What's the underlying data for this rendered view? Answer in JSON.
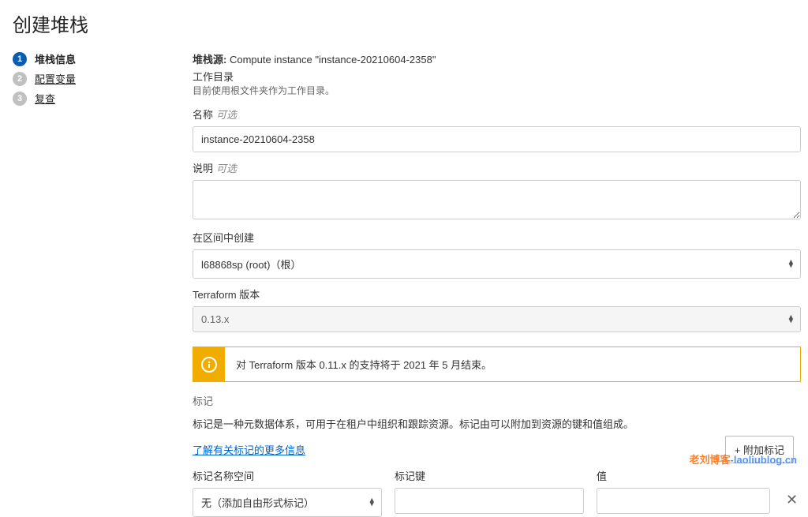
{
  "page_title": "创建堆栈",
  "steps": [
    {
      "num": "1",
      "label": "堆栈信息",
      "active": true
    },
    {
      "num": "2",
      "label": "配置变量",
      "active": false
    },
    {
      "num": "3",
      "label": "复查",
      "active": false
    }
  ],
  "stack_source": {
    "label": "堆栈源:",
    "value": "Compute instance \"instance-20210604-2358\""
  },
  "workdir": {
    "label": "工作目录",
    "hint": "目前使用根文件夹作为工作目录。"
  },
  "name_field": {
    "label": "名称",
    "optional": "可选",
    "value": "instance-20210604-2358"
  },
  "desc_field": {
    "label": "说明",
    "optional": "可选",
    "value": ""
  },
  "compartment": {
    "label": "在区间中创建",
    "value": "l68868sp (root)（根）"
  },
  "terraform": {
    "label": "Terraform 版本",
    "value": "0.13.x"
  },
  "notice": "对 Terraform 版本 0.11.x 的支持将于 2021 年 5 月结束。",
  "tags": {
    "section": "标记",
    "desc": "标记是一种元数据体系，可用于在租户中组织和跟踪资源。标记由可以附加到资源的键和值组成。",
    "link": "了解有关标记的更多信息",
    "cols": {
      "namespace": "标记名称空间",
      "key": "标记键",
      "value": "值"
    },
    "namespace_value": "无（添加自由形式标记）",
    "add_button": "+ 附加标记"
  },
  "watermark": {
    "a": "老刘博客",
    "b": "-laoliublog.cn"
  }
}
